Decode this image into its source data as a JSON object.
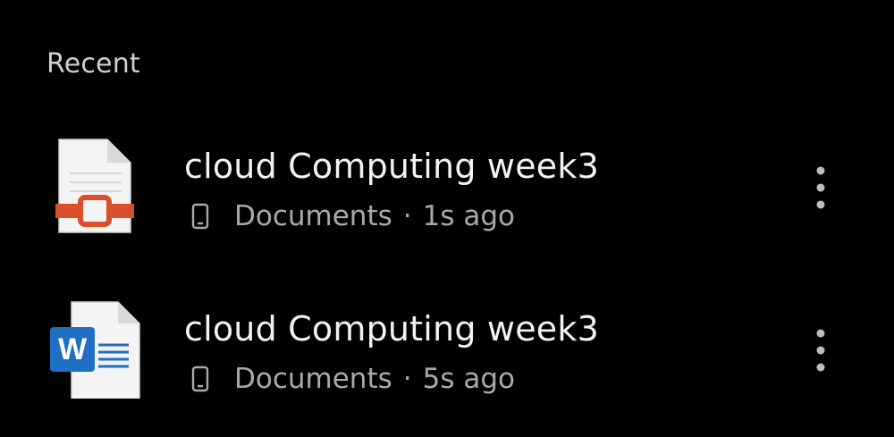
{
  "section": {
    "title": "Recent"
  },
  "files": [
    {
      "type": "pdf",
      "title": "cloud Computing week3",
      "location": "Documents",
      "separator": "·",
      "time": "1s ago",
      "icon": "pdf-file-icon"
    },
    {
      "type": "word",
      "title": "cloud Computing week3",
      "location": "Documents",
      "separator": "·",
      "time": "5s ago",
      "icon": "word-file-icon",
      "badge_letter": "W"
    }
  ],
  "colors": {
    "background": "#000000",
    "pdf_accent": "#d94f2a",
    "word_accent": "#1f6fc4"
  }
}
